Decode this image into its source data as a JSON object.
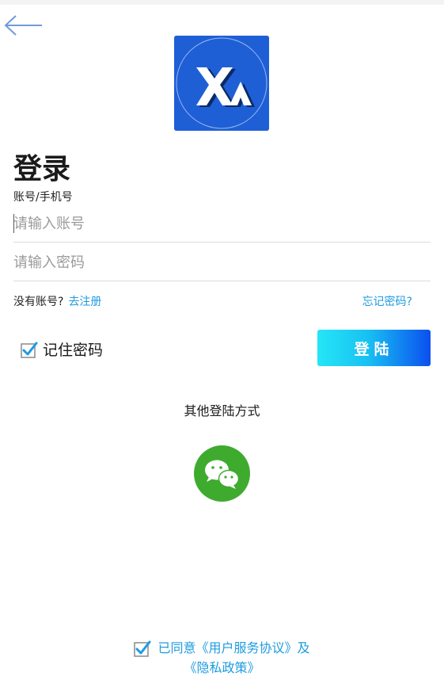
{
  "header": {
    "back_icon": "back-arrow-icon"
  },
  "logo": {
    "alt": "XA",
    "icon": "app-logo"
  },
  "title": "登录",
  "account_label": "账号/手机号",
  "account_input": {
    "placeholder": "请输入账号",
    "value": ""
  },
  "password_input": {
    "placeholder": "请输入密码",
    "value": ""
  },
  "register": {
    "prompt": "没有账号?",
    "link": "去注册"
  },
  "forgot_password": "忘记密码?",
  "remember": {
    "label": "记住密码",
    "checked": true
  },
  "login_button": "登陆",
  "other_login_label": "其他登陆方式",
  "wechat_icon": "wechat-icon",
  "agreement": {
    "line1": "已同意《用户服务协议》及",
    "line2": "《隐私政策》",
    "checked": true
  },
  "colors": {
    "accent": "#1e9be0",
    "logo_bg": "#1f5fd6",
    "wechat": "#3eab2e",
    "button_from": "#25e6f6",
    "button_to": "#0b4ff0"
  }
}
